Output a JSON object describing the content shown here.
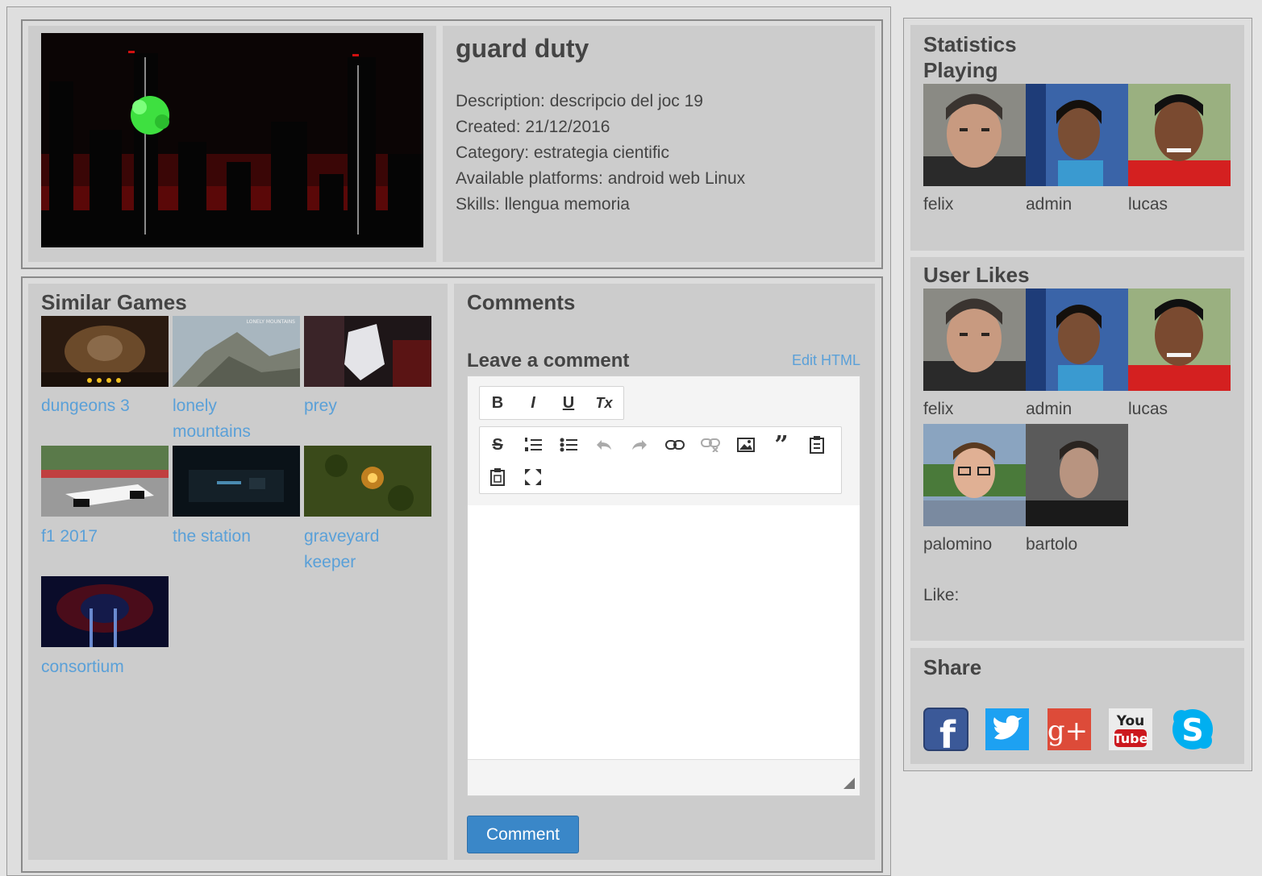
{
  "game": {
    "title": "guard duty",
    "description": "Description: descripcio del joc 19",
    "created": "Created: 21/12/2016",
    "category": "Category: estrategia cientific",
    "platforms": "Available platforms: android web Linux",
    "skills": "Skills: llengua memoria"
  },
  "similar": {
    "heading": "Similar Games",
    "items": [
      {
        "line1": "dungeons 3",
        "line2": ""
      },
      {
        "line1": "lonely",
        "line2": "mountains"
      },
      {
        "line1": "prey",
        "line2": ""
      },
      {
        "line1": "f1 2017",
        "line2": ""
      },
      {
        "line1": "the station",
        "line2": ""
      },
      {
        "line1": "graveyard",
        "line2": "keeper"
      },
      {
        "line1": "consortium",
        "line2": ""
      }
    ],
    "thumb_text": {
      "lonely": "LONELY MOUNTAINS"
    }
  },
  "comments": {
    "heading": "Comments",
    "leave": "Leave a comment",
    "edit_html": "Edit HTML",
    "button": "Comment",
    "toolbar": {
      "bold": "B",
      "italic": "I",
      "underline": "U",
      "clear": "Tx",
      "strike": "S",
      "quote": "”"
    }
  },
  "stats": {
    "heading": "Statistics",
    "playing_label": "Playing",
    "playing": [
      "felix",
      "admin",
      "lucas"
    ]
  },
  "likes": {
    "heading": "User Likes",
    "users": [
      "felix",
      "admin",
      "lucas",
      "palomino",
      "bartolo"
    ],
    "like_label": "Like:"
  },
  "share": {
    "heading": "Share",
    "youtube_top": "You",
    "youtube_bottom": "Tube",
    "gplus": "g+",
    "facebook": "f",
    "skype": "S"
  },
  "colors": {
    "link": "#5aa0d8",
    "button": "#3a87c8",
    "facebook": "#3b5998",
    "twitter": "#1da1f2",
    "gplus": "#dd4b39",
    "youtube": "#cc181e",
    "skype": "#00aff0"
  }
}
